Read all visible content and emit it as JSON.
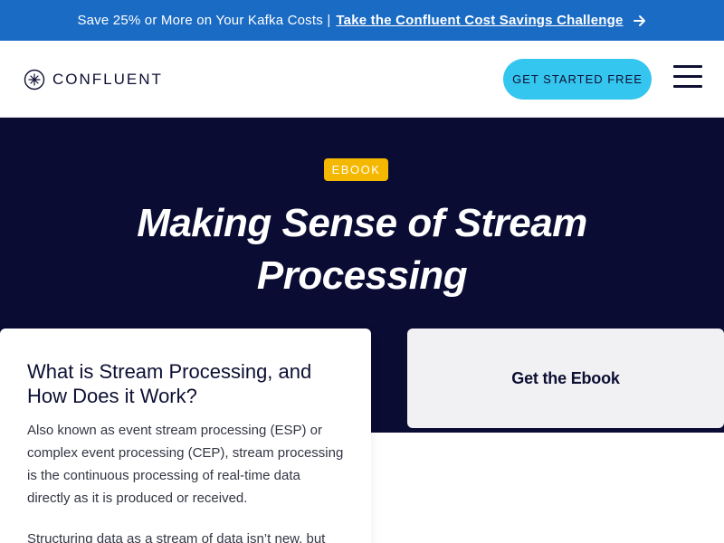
{
  "promo": {
    "text": "Save 25% or More on Your Kafka Costs |",
    "link_label": "Take the Confluent Cost Savings Challenge",
    "arrow_icon": "arrow-right-icon"
  },
  "header": {
    "logo_text": "CONFLUENT",
    "logo_icon": "confluent-logo-icon",
    "cta_label": "GET STARTED FREE",
    "menu_icon": "hamburger-menu-icon"
  },
  "hero": {
    "badge": "EBOOK",
    "title": "Making Sense of Stream Processing"
  },
  "content": {
    "heading": "What is Stream Processing, and How Does it Work?",
    "paragraphs": [
      "Also known as event stream processing (ESP) or complex event processing (CEP), stream processing is the continuous processing of real-time data directly as it is produced or received.",
      "Structuring data as a stream of data isn’t new, but"
    ]
  },
  "form_card": {
    "label": "Get the Ebook"
  },
  "colors": {
    "promo_bg": "#1a6bc4",
    "hero_bg": "#0a0c33",
    "cta_bg": "#35c6f0",
    "badge_bg": "#f5b800",
    "card_bg": "#f1f1f3"
  }
}
